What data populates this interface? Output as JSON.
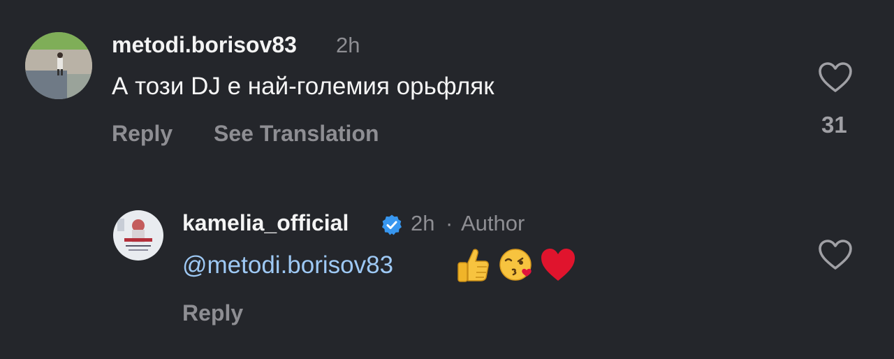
{
  "comments": [
    {
      "username": "metodi.borisov83",
      "time": "2h",
      "text": "А този DJ е най-големия орьфляк",
      "reply_label": "Reply",
      "see_translation_label": "See Translation",
      "like_count": "31",
      "avatar_icon": "profile-photo"
    },
    {
      "username": "kamelia_official",
      "verified": true,
      "verified_color": "#3897f0",
      "time": "2h",
      "separator": "·",
      "author_label": "Author",
      "mention": "@metodi.borisov83",
      "emojis": [
        "thumbs-up",
        "kissing-face-with-heart",
        "red-heart"
      ],
      "reply_label": "Reply",
      "avatar_icon": "album-cover-avatar"
    }
  ],
  "colors": {
    "background": "#24262b",
    "muted_text": "#8e8e93",
    "mention": "#9ec9f5"
  }
}
